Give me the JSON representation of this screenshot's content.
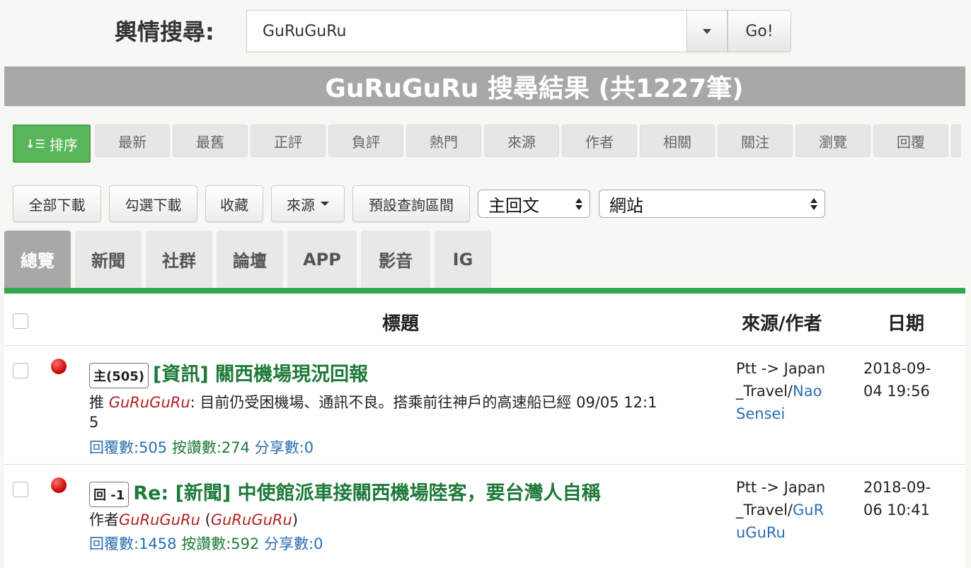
{
  "search": {
    "label": "輿情搜尋:",
    "value": "GuRuGuRu",
    "go_label": "Go!"
  },
  "result_header": "GuRuGuRu 搜尋結果 (共1227筆)",
  "sort": {
    "main_label": "排序",
    "items": [
      "最新",
      "最舊",
      "正評",
      "負評",
      "熱門",
      "來源",
      "作者",
      "相關",
      "關注",
      "瀏覽",
      "回覆"
    ]
  },
  "actions": {
    "download_all": "全部下載",
    "download_checked": "勾選下載",
    "favorite": "收藏",
    "source": "來源",
    "preset_range": "預設查詢區間",
    "select_type": "主回文",
    "select_site": "網站"
  },
  "categories": [
    "總覽",
    "新聞",
    "社群",
    "論壇",
    "APP",
    "影音",
    "IG"
  ],
  "table": {
    "headers": {
      "title": "標題",
      "source_author": "來源/作者",
      "date": "日期"
    },
    "rows": [
      {
        "badge": "主(505)",
        "title": "[資訊] 關西機場現況回報",
        "snippet_prefix": "推 ",
        "snippet_author": "GuRuGuRu",
        "snippet_text": ": 目前仍受困機場、通訊不良。搭乘前往神戶的高速船已經 09/05 12:1",
        "snippet_cont": "5",
        "stats_reply": "回覆數:505",
        "stats_like": "按讚數:274",
        "stats_share": "分享數:0",
        "src_line1": "Ptt -> Japan",
        "src_line2": "_Travel/",
        "src_author1": "Nao",
        "src_author2": "Sensei",
        "date1": "2018-09-",
        "date2": "04 19:56"
      },
      {
        "badge": "回 -1",
        "title": "Re: [新聞] 中使館派車接關西機場陸客，要台灣人自稱",
        "author_prefix": "作者",
        "author_name": "GuRuGuRu",
        "author_open": " (",
        "author_name2": "GuRuGuRu",
        "author_close": ")",
        "stats_reply": "回覆數:1458",
        "stats_like": "按讚數:592",
        "stats_share": "分享數:0",
        "src_line1": "Ptt -> Japan",
        "src_line2": "_Travel/",
        "src_author1": "GuR",
        "src_author2": "uGuRu",
        "date1": "2018-09-",
        "date2": "06 10:41"
      }
    ]
  }
}
